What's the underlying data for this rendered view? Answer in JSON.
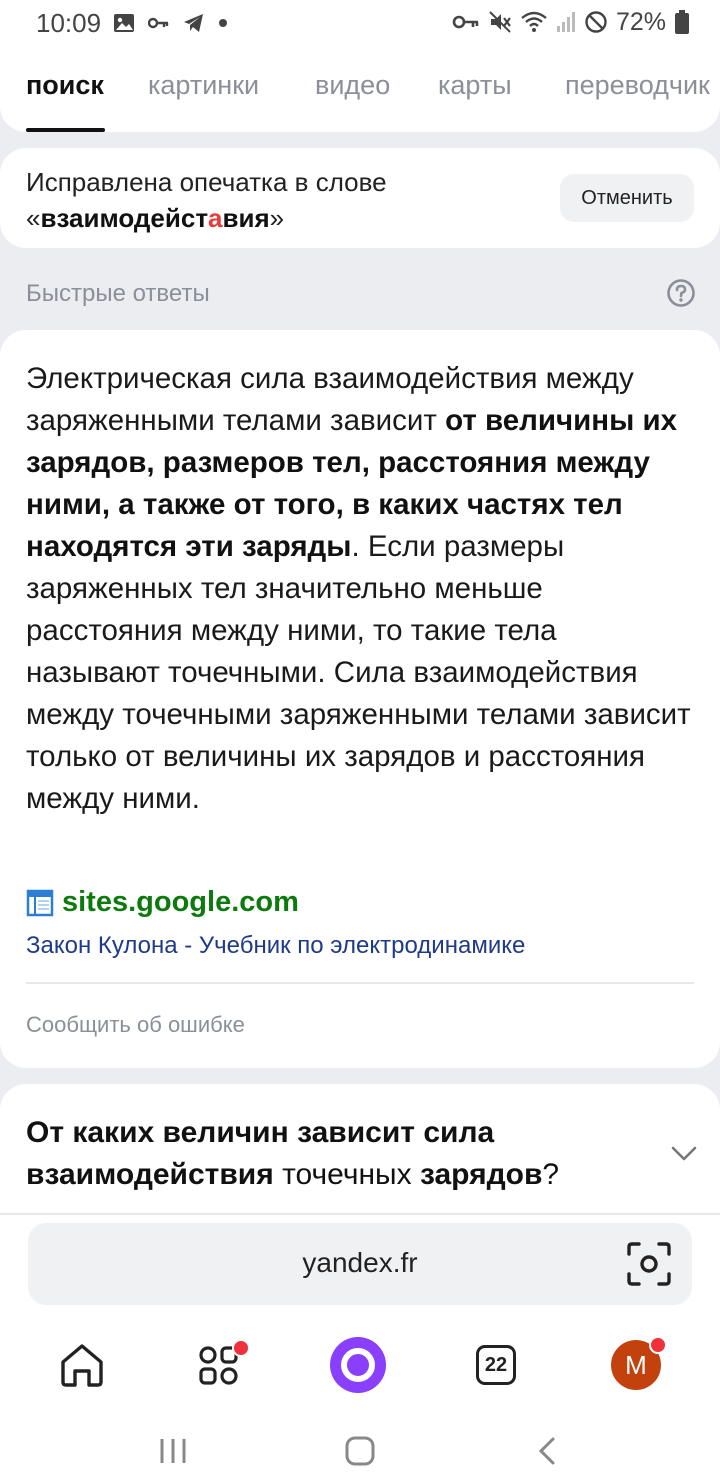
{
  "status": {
    "time": "10:09",
    "battery": "72%",
    "left_icons": [
      "image-icon",
      "key-icon",
      "telegram-icon",
      "dot-icon"
    ],
    "right_icons": [
      "vpn-key-icon",
      "mute-icon",
      "wifi-icon",
      "signal-icon",
      "blocked-icon",
      "battery-icon"
    ]
  },
  "tabs": [
    {
      "label": "поиск",
      "active": true
    },
    {
      "label": "картинки",
      "active": false
    },
    {
      "label": "видео",
      "active": false
    },
    {
      "label": "карты",
      "active": false
    },
    {
      "label": "переводчик",
      "active": false
    }
  ],
  "typo": {
    "line1": "Исправлена опечатка в слове",
    "open_quote": "«",
    "word_part1": "взаимодейст",
    "word_highlight": "а",
    "word_part2": "вия",
    "close_quote": "»",
    "cancel_label": "Отменить"
  },
  "quick_answers": {
    "header": "Быстрые ответы",
    "text_part1": "Электрическая сила взаимодействия между заряженными телами зависит ",
    "text_bold": "от величины их зарядов, размеров тел, расстояния между ними, а также от того, в каких частях тел находятся эти заряды",
    "text_part2": ". Если размеры заряженных тел значительно меньше расстояния между ними, то такие тела называют точечными. Сила взаимодействия между точечными заряженными телами зависит только от величины их зарядов и расстояния между ними.",
    "source_domain": "sites.google.com",
    "source_title": "Закон Кулона - Учебник по электродинамике",
    "report_label": "Сообщить об ошибке"
  },
  "related": {
    "b1": "От каких величин зависит сила взаимодействия",
    "plain": " точечных ",
    "b2": "зарядов",
    "end": "?"
  },
  "browser": {
    "url": "yandex.fr",
    "tab_count": "22",
    "avatar_letter": "M"
  },
  "colors": {
    "accent_alice": "#8a3ffc",
    "source_green": "#0c7a0c",
    "link_blue": "#1e3a8a",
    "typo_red": "#e63c3c",
    "notification_red": "#f0303a"
  }
}
